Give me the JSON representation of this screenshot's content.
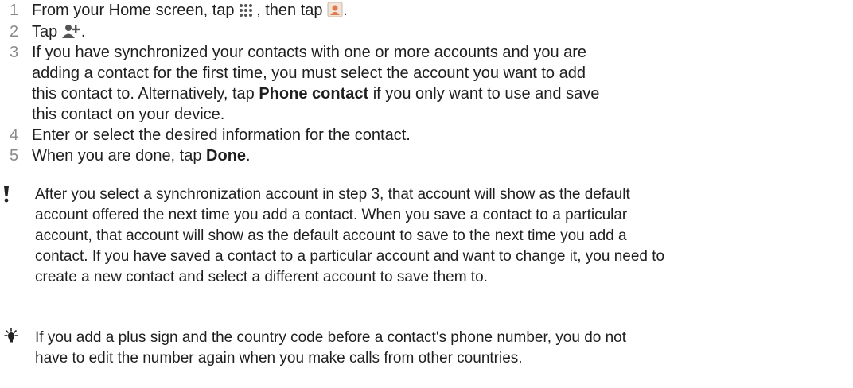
{
  "steps": [
    {
      "num": "1",
      "p1": "From your Home screen, tap ",
      "p2": ", then tap ",
      "p3": ".",
      "icon_a": "app-grid-icon",
      "icon_b": "contacts-app-icon"
    },
    {
      "num": "2",
      "p1": "Tap ",
      "p2": ".",
      "icon_a": "add-contact-icon"
    },
    {
      "num": "3",
      "lines": [
        "If you have synchronized your contacts with one or more accounts and you are",
        "adding a contact for the first time, you must select the account you want to add",
        "this contact to. Alternatively, tap ",
        "this contact on your device."
      ],
      "bold": "Phone contact",
      "line3_tail": " if you only want to use and save"
    },
    {
      "num": "4",
      "text": "Enter or select the desired information for the contact."
    },
    {
      "num": "5",
      "p1": "When you are done, tap ",
      "bold": "Done",
      "p2": "."
    }
  ],
  "important_note": {
    "icon": "exclamation-icon",
    "lines": [
      "After you select a synchronization account in step 3, that account will show as the default",
      "account offered the next time you add a contact. When you save a contact to a particular",
      "account, that account will show as the default account to save to the next time you add a",
      "contact. If you have saved a contact to a particular account and want to change it, you need to",
      "create a new contact and select a different account to save them to."
    ]
  },
  "tip_note": {
    "icon": "lightbulb-icon",
    "lines": [
      "If you add a plus sign and the country code before a contact's phone number, you do not",
      "have to edit the number again when you make calls from other countries."
    ]
  },
  "colors": {
    "text": "#1f1f1f",
    "step_number": "#8a8a8a",
    "contacts_icon": "#e0784a"
  }
}
